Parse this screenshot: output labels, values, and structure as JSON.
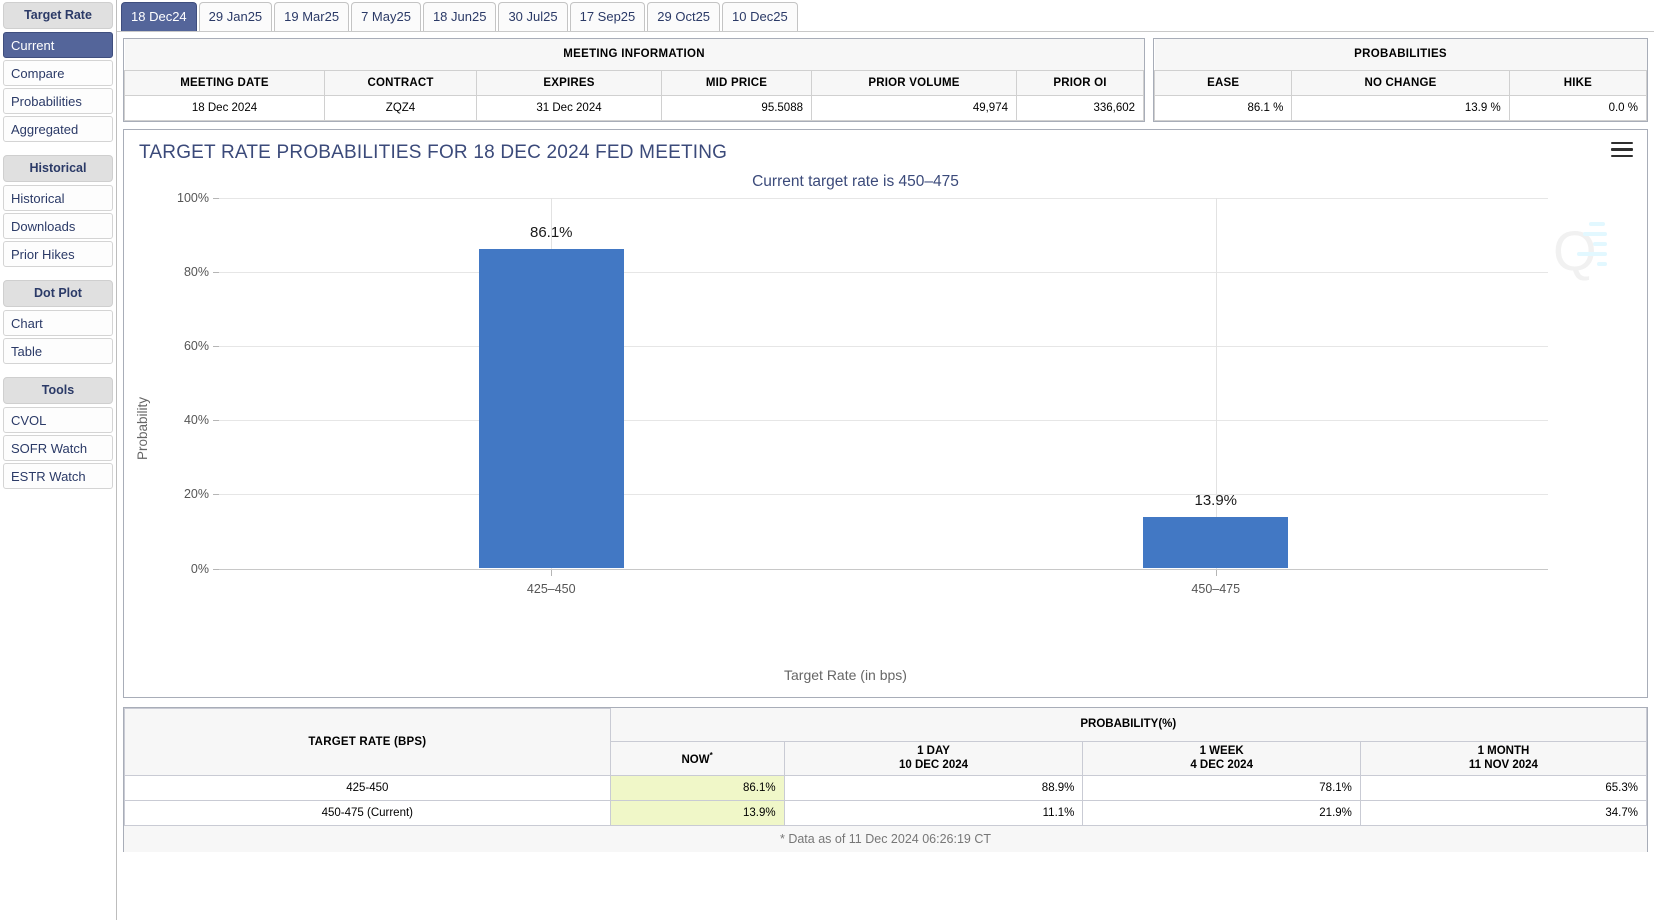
{
  "sidebar": {
    "groups": [
      {
        "header": "Target Rate",
        "items": [
          {
            "label": "Current",
            "active": true
          },
          {
            "label": "Compare",
            "active": false
          },
          {
            "label": "Probabilities",
            "active": false
          },
          {
            "label": "Aggregated",
            "active": false
          }
        ]
      },
      {
        "header": "Historical",
        "items": [
          {
            "label": "Historical",
            "active": false
          },
          {
            "label": "Downloads",
            "active": false
          },
          {
            "label": "Prior Hikes",
            "active": false
          }
        ]
      },
      {
        "header": "Dot Plot",
        "items": [
          {
            "label": "Chart",
            "active": false
          },
          {
            "label": "Table",
            "active": false
          }
        ]
      },
      {
        "header": "Tools",
        "items": [
          {
            "label": "CVOL",
            "active": false
          },
          {
            "label": "SOFR Watch",
            "active": false
          },
          {
            "label": "ESTR Watch",
            "active": false
          }
        ]
      }
    ]
  },
  "tabs": [
    {
      "label": "18 Dec24",
      "active": true
    },
    {
      "label": "29 Jan25",
      "active": false
    },
    {
      "label": "19 Mar25",
      "active": false
    },
    {
      "label": "7 May25",
      "active": false
    },
    {
      "label": "18 Jun25",
      "active": false
    },
    {
      "label": "30 Jul25",
      "active": false
    },
    {
      "label": "17 Sep25",
      "active": false
    },
    {
      "label": "29 Oct25",
      "active": false
    },
    {
      "label": "10 Dec25",
      "active": false
    }
  ],
  "meeting_info": {
    "title": "MEETING INFORMATION",
    "headers": [
      "MEETING DATE",
      "CONTRACT",
      "EXPIRES",
      "MID PRICE",
      "PRIOR VOLUME",
      "PRIOR OI"
    ],
    "values": [
      "18 Dec 2024",
      "ZQZ4",
      "31 Dec 2024",
      "95.5088",
      "49,974",
      "336,602"
    ]
  },
  "probabilities_panel": {
    "title": "PROBABILITIES",
    "headers": [
      "EASE",
      "NO CHANGE",
      "HIKE"
    ],
    "values": [
      "86.1 %",
      "13.9 %",
      "0.0 %"
    ]
  },
  "chart_data": {
    "type": "bar",
    "title": "TARGET RATE PROBABILITIES FOR 18 DEC 2024 FED MEETING",
    "subtitle": "Current target rate is 450–475",
    "categories": [
      "425–450",
      "450–475"
    ],
    "values": [
      86.1,
      13.9
    ],
    "value_labels": [
      "86.1%",
      "13.9%"
    ],
    "xlabel": "Target Rate (in bps)",
    "ylabel": "Probability",
    "ylim": [
      0,
      100
    ],
    "yticks": [
      0,
      20,
      40,
      60,
      80,
      100
    ],
    "ytick_labels": [
      "0%",
      "20%",
      "40%",
      "60%",
      "80%",
      "100%"
    ],
    "bar_color": "#4278c4",
    "grid": true,
    "legend": "none",
    "menu_icon": "hamburger-icon"
  },
  "bottom_table": {
    "left_header": "TARGET RATE (BPS)",
    "group_header": "PROBABILITY(%)",
    "columns": [
      {
        "line1": "NOW",
        "line2": "",
        "footnote_mark": "*"
      },
      {
        "line1": "1 DAY",
        "line2": "10 DEC 2024",
        "footnote_mark": ""
      },
      {
        "line1": "1 WEEK",
        "line2": "4 DEC 2024",
        "footnote_mark": ""
      },
      {
        "line1": "1 MONTH",
        "line2": "11 NOV 2024",
        "footnote_mark": ""
      }
    ],
    "rows": [
      {
        "rate": "425-450",
        "values": [
          "86.1%",
          "88.9%",
          "78.1%",
          "65.3%"
        ]
      },
      {
        "rate": "450-475 (Current)",
        "values": [
          "13.9%",
          "11.1%",
          "21.9%",
          "34.7%"
        ]
      }
    ],
    "footnote": "* Data as of 11 Dec 2024 06:26:19 CT"
  }
}
